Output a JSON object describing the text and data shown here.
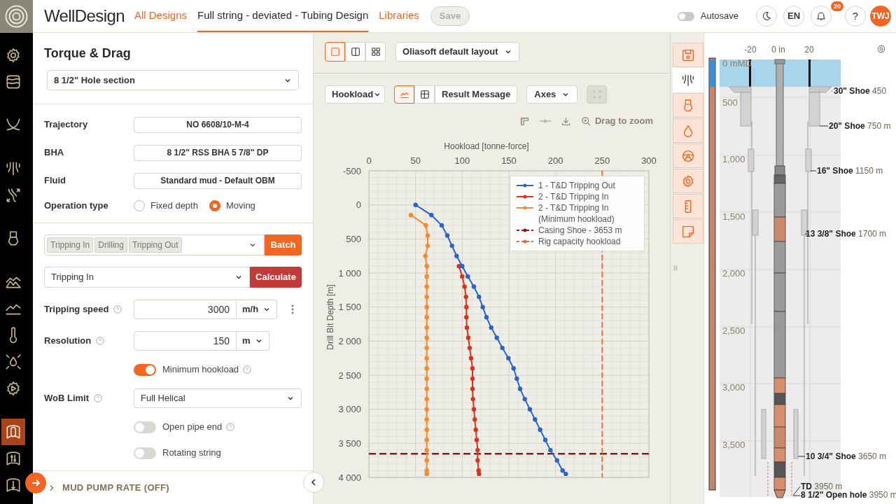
{
  "header": {
    "app_name": "WellDesign",
    "nav": [
      {
        "label": "All Designs",
        "selected": false
      },
      {
        "label": "Full string - deviated - Tubing Design",
        "selected": true
      },
      {
        "label": "Libraries",
        "selected": false
      }
    ],
    "save_button": {
      "label": "Save",
      "disabled": true
    },
    "autosave": {
      "label": "Autosave",
      "on": false
    },
    "language": "EN",
    "notifications": "20",
    "help": "?",
    "user_initials": "TWJ"
  },
  "nav_rail": [
    {
      "items": [
        {
          "kind": "settings",
          "selected": false
        },
        {
          "kind": "layers",
          "selected": false
        }
      ]
    },
    {
      "items": [
        {
          "kind": "trajectory",
          "selected": false
        }
      ]
    },
    {
      "items": [
        {
          "kind": "lines",
          "selected": false
        },
        {
          "kind": "arrows",
          "selected": false
        }
      ]
    },
    {
      "items": [
        {
          "kind": "tool",
          "selected": false
        }
      ]
    },
    {
      "items": [
        {
          "kind": "terrain",
          "selected": false
        },
        {
          "kind": "chart",
          "selected": false
        },
        {
          "kind": "thermometer",
          "selected": false
        },
        {
          "kind": "drop",
          "selected": false
        },
        {
          "kind": "gear-play",
          "selected": false
        }
      ]
    },
    {
      "items": [
        {
          "kind": "casing",
          "selected": true
        },
        {
          "kind": "casing-arrows",
          "selected": false
        },
        {
          "kind": "casing-down",
          "selected": false
        }
      ]
    }
  ],
  "panel": {
    "title": "Torque & Drag",
    "section_select": "8 1/2\" Hole section",
    "fields": [
      {
        "label": "Trajectory",
        "value": "NO 6608/10-M-4"
      },
      {
        "label": "BHA",
        "value": "8 1/2\" RSS BHA 5 7/8\" DP"
      },
      {
        "label": "Fluid",
        "value": "Standard mud - Default OBM"
      }
    ],
    "operation_type": {
      "label": "Operation type",
      "options": [
        {
          "label": "Fixed depth",
          "selected": false
        },
        {
          "label": "Moving",
          "selected": true
        }
      ]
    },
    "batch": {
      "chips": [
        "Tripping In",
        "Drilling",
        "Tripping Out"
      ],
      "button": "Batch"
    },
    "calculate": {
      "value": "Tripping In",
      "button": "Calculate"
    },
    "settings": [
      {
        "kind": "input",
        "label": "Tripping speed",
        "help": true,
        "value": "3000",
        "unit": "m/h",
        "menu": true
      },
      {
        "kind": "input",
        "label": "Resolution",
        "help": true,
        "value": "150",
        "unit": "m",
        "menu": false
      },
      {
        "kind": "toggle",
        "label": "Minimum hookload",
        "help": true,
        "on": true
      },
      {
        "kind": "select",
        "label": "WoB Limit",
        "help": true,
        "value": "Full Helical"
      },
      {
        "kind": "toggle",
        "label": "Open pipe end",
        "help": true,
        "on": false
      },
      {
        "kind": "toggle",
        "label": "Rotating string",
        "help": false,
        "on": false
      }
    ],
    "collapsed_section": {
      "label": "MUD PUMP RATE (OFF)",
      "expanded": false
    }
  },
  "layout_toolbar": {
    "layouts": [
      {
        "kind": "single",
        "selected": true
      },
      {
        "kind": "split",
        "selected": false
      },
      {
        "kind": "grid",
        "selected": false
      }
    ],
    "layout_select": "Oliasoft default layout"
  },
  "chart_toolbar": {
    "result_select": "Hookload",
    "views": [
      {
        "kind": "chart",
        "selected": true
      },
      {
        "kind": "table",
        "selected": false
      },
      {
        "kind": "text",
        "label": "Result Message",
        "selected": false
      }
    ],
    "axes_select": "Axes",
    "fullscreen": {
      "disabled": true
    },
    "zoom_label": "Drag to zoom"
  },
  "chart_data": {
    "type": "line",
    "orientation": "horizontal",
    "xlabel": "Hookload [tonne-force]",
    "ylabel": "Drill Bit Depth [m]",
    "xlim": [
      0,
      300
    ],
    "ylim": [
      4000,
      -500
    ],
    "grid": true,
    "legend": true,
    "xticks": [
      0,
      50,
      100,
      150,
      200,
      250,
      300
    ],
    "yticks": [
      -500,
      0,
      500,
      {
        "value": 1000,
        "label": "1 000"
      },
      {
        "value": 1500,
        "label": "1 500"
      },
      {
        "value": 2000,
        "label": "2 000"
      },
      {
        "value": 2500,
        "label": "2 500"
      },
      {
        "value": 3000,
        "label": "3 000"
      },
      {
        "value": 3500,
        "label": "3 500"
      },
      {
        "value": 4000,
        "label": "4 000"
      }
    ],
    "x": [
      0,
      150,
      300,
      450,
      600,
      750,
      900,
      1050,
      1200,
      1350,
      1500,
      1650,
      1800,
      1950,
      2100,
      2250,
      2400,
      2550,
      2700,
      2850,
      3000,
      3150,
      3300,
      3450,
      3600,
      3750,
      3900,
      3950
    ],
    "series": [
      {
        "name": "1 - T&D Tripping Out",
        "color": "#2b63c9",
        "marker": "circle",
        "values": [
          50,
          67,
          78,
          84,
          89,
          94,
          100,
          106,
          112.5,
          118,
          122,
          126,
          131,
          137,
          143,
          149.5,
          155,
          158.5,
          162,
          167,
          172.5,
          178,
          183.5,
          189,
          194.5,
          201.5,
          207.5,
          211
        ]
      },
      {
        "name": "2 - T&D Tripping In",
        "color": "#d9331f",
        "marker": "circle",
        "values": [
          null,
          null,
          null,
          null,
          null,
          null,
          96.5,
          100,
          102.5,
          104,
          104.5,
          104.5,
          105,
          106.5,
          108,
          109.5,
          111,
          111,
          111,
          111.5,
          112.5,
          113.5,
          114.5,
          115.5,
          116.5,
          116.5,
          117.5,
          118
        ]
      },
      {
        "name": "2 - T&D Tripping In (Minimum hookload)",
        "color": "#f7882b",
        "marker": "circle",
        "values": [
          null,
          45,
          61,
          63,
          63,
          60.5,
          62,
          62,
          62,
          62,
          62,
          62,
          62,
          62,
          62,
          62,
          62,
          62,
          62,
          62,
          62,
          62,
          62,
          62,
          62,
          62,
          62,
          62
        ]
      }
    ],
    "ref_lines": [
      {
        "axis": "y",
        "value": 3653,
        "label": "Casing Shoe - 3653 m",
        "color": "#8e1b1b"
      },
      {
        "axis": "x",
        "value": 250,
        "label": "Rig capacity hookload",
        "color": "#ee6a32"
      }
    ]
  },
  "side_tabs": [
    {
      "kind": "save",
      "selected": false
    },
    {
      "kind": "well",
      "selected": true
    },
    {
      "kind": "tool",
      "selected": false
    },
    {
      "kind": "fluid",
      "selected": false
    },
    {
      "kind": "steering",
      "selected": false
    },
    {
      "kind": "settings",
      "selected": false
    },
    {
      "kind": "ruler",
      "selected": false
    },
    {
      "kind": "note",
      "selected": false
    }
  ],
  "wellbore": {
    "axis_labels": [
      "-20",
      "0 in",
      "20"
    ],
    "depth_labels": [
      "0 mMD",
      "500",
      "1,000",
      "1,500",
      "2,000",
      "2,500",
      "3,000",
      "3,500"
    ],
    "shoe_labels": [
      "**30\" Shoe** 450",
      "**20\" Shoe** 750 m",
      "**16\" Shoe** 1150 m",
      "**13 3/8\" Shoe** 1700 m",
      "**10 3/4\" Shoe** 3650 m",
      "**TD** 3950 m",
      "**8 1/2\" Open hole** 3950 m"
    ]
  }
}
